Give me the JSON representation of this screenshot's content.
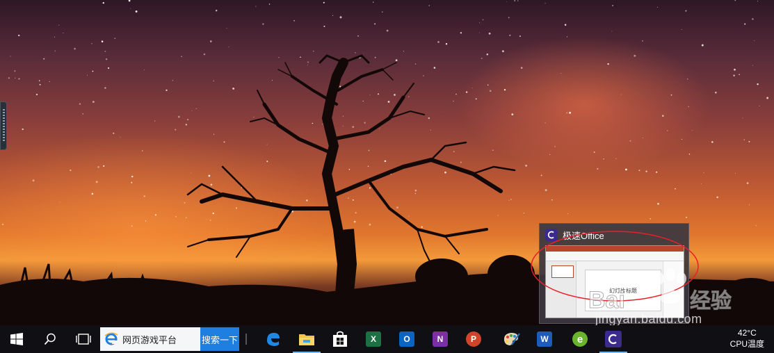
{
  "taskbar": {
    "search_text": "网页游戏平台",
    "search_button": "搜索一下",
    "apps": [
      {
        "name": "edge-icon",
        "label": "Edge"
      },
      {
        "name": "file-explorer-icon",
        "label": "File Explorer"
      },
      {
        "name": "store-icon",
        "label": "Store"
      },
      {
        "name": "excel-icon",
        "label": "X"
      },
      {
        "name": "outlook-icon",
        "label": "O"
      },
      {
        "name": "onenote-icon",
        "label": "N"
      },
      {
        "name": "powerpoint-icon",
        "label": "P"
      },
      {
        "name": "paint-icon",
        "label": "Paint"
      },
      {
        "name": "word-icon",
        "label": "W"
      },
      {
        "name": "browser-icon",
        "label": "e"
      },
      {
        "name": "jisu-office-icon",
        "label": "C"
      }
    ],
    "tray": {
      "temperature": "42°C",
      "label": "CPU温度"
    }
  },
  "preview": {
    "title": "极速Office",
    "slide_title": "幻灯片标题"
  },
  "watermark": {
    "brand": "Baidu经验",
    "site": "jingyan.baidu.com"
  },
  "colors": {
    "annotation": "#e8202a",
    "taskbar": "#0f0f14",
    "accent": "#1e7fe0"
  }
}
